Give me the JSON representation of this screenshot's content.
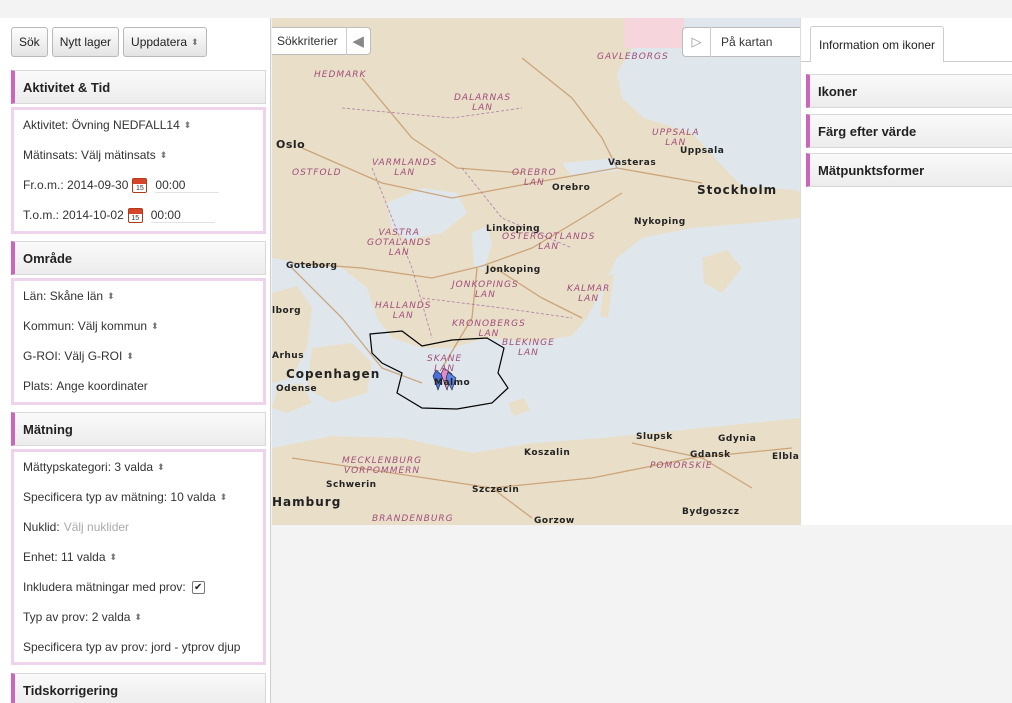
{
  "toolbar": {
    "search": "Sök",
    "new_layer": "Nytt lager",
    "update": "Uppdatera"
  },
  "activity_time": {
    "title": "Aktivitet & Tid",
    "activity_label": "Aktivitet:",
    "activity_value": "Övning NEDFALL14",
    "measure_label": "Mätinsats:",
    "measure_value": "Välj mätinsats",
    "from_label": "Fr.o.m.:",
    "from_date": "2014-09-30",
    "from_time": "00:00",
    "to_label": "T.o.m.:",
    "to_date": "2014-10-02",
    "to_time": "00:00",
    "calendar_glyph": "15"
  },
  "area": {
    "title": "Område",
    "county_label": "Län:",
    "county_value": "Skåne län",
    "municipality_label": "Kommun:",
    "municipality_value": "Välj kommun",
    "groi_label": "G-ROI:",
    "groi_value": "Välj G-ROI",
    "place_label": "Plats:",
    "place_value": "Ange koordinater"
  },
  "measurement": {
    "title": "Mätning",
    "category_label": "Mättypskategori:",
    "category_value": "3 valda",
    "specify_label": "Specificera typ av mätning:",
    "specify_value": "10 valda",
    "nuclide_label": "Nuklid:",
    "nuclide_placeholder": "Välj nuklider",
    "unit_label": "Enhet:",
    "unit_value": "11 valda",
    "include_label": "Inkludera mätningar med prov:",
    "include_checked": true,
    "sample_type_label": "Typ av prov:",
    "sample_type_value": "2 valda",
    "specify_sample_label": "Specificera typ av prov:",
    "specify_sample_value": "jord - ytprov djup"
  },
  "time_correction": {
    "title": "Tidskorrigering"
  },
  "map": {
    "criteria_tab": "Sökkriterier",
    "on_map_tab": "På kartan",
    "labels": {
      "oslo": "Oslo",
      "stockholm": "Stockholm",
      "uppsala": "Uppsala",
      "vasteras": "Vasteras",
      "orebro": "Orebro",
      "nykoping": "Nykoping",
      "linkoping": "Linkoping",
      "jonkoping": "Jonkoping",
      "goteborg": "Goteborg",
      "copenhagen": "Copenhagen",
      "malmo": "Malmo",
      "odense": "Odense",
      "arhus": "Arhus",
      "koszalin": "Koszalin",
      "slupsk": "Slupsk",
      "gdynia": "Gdynia",
      "gdansk": "Gdansk",
      "elblag": "Elbla",
      "szczecin": "Szczecin",
      "hamburg": "Hamburg",
      "schwerin": "Schwerin",
      "bydgoszcz": "Bydgoszcz",
      "gorzow": "Gorzow",
      "aalborg": "lborg",
      "hedmark": "HEDMARK",
      "dalarnas": "DALARNAS\nLAN",
      "varmlands": "VARMLANDS\nLAN",
      "vastra": "VASTRA\nGOTALANDS\nLAN",
      "ostergotlands": "OSTERGOTLANDS\nLAN",
      "jonkopings": "JONKOPINGS\nLAN",
      "kalmar": "KALMAR\nLAN",
      "halland": "HALLANDS\nLAN",
      "kronoberg": "KRONOBERGS\nLAN",
      "blekinge": "BLEKINGE\nLAN",
      "skane": "SKANE\nLAN",
      "orebro_lan": "OREBRO\nLAN",
      "uppsala_lan": "UPPSALA\nLAN",
      "gavle": "GAVLEBORGS",
      "pomorskie": "POMORSKIE",
      "mecklenburg": "MECKLENBURG\nVORPOMMERN",
      "ostfold": "OSTFOLD",
      "brandenburg": "BRANDENBURG"
    }
  },
  "info_panel": {
    "tab": "Information om ikoner",
    "sections": [
      "Ikoner",
      "Färg efter värde",
      "Mätpunktsformer"
    ]
  },
  "colors": {
    "accent": "#cc66bb",
    "section_border": "#efd3ec",
    "water": "#dfe7ec",
    "land": "#e9dfc9",
    "road": "#c79a6b"
  },
  "icons": {
    "collapse": "chevron-left-icon",
    "expand": "play-right-icon",
    "calendar": "calendar-icon",
    "marker": "map-marker-icon"
  }
}
